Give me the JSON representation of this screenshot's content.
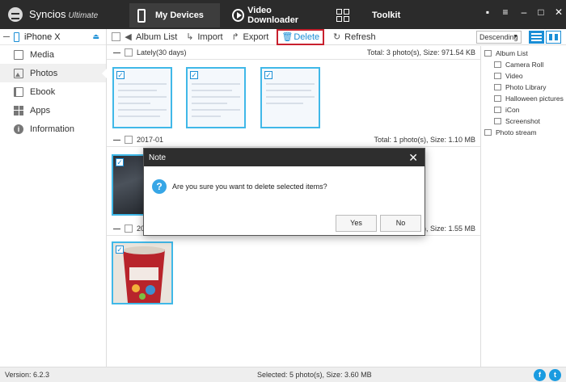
{
  "app": {
    "name": "Syncios",
    "edition": "Ultimate"
  },
  "nav_tabs": [
    {
      "label": "My Devices",
      "icon": "phone-icon"
    },
    {
      "label": "Video Downloader",
      "icon": "play-icon"
    },
    {
      "label": "Toolkit",
      "icon": "toolkit-grid-icon"
    }
  ],
  "window_controls": [
    "message-icon",
    "menu-icon",
    "minimize-icon",
    "maximize-icon",
    "close-icon"
  ],
  "device": {
    "name": "iPhone X"
  },
  "sidebar": {
    "items": [
      {
        "label": "Media",
        "icon": "media-icon"
      },
      {
        "label": "Photos",
        "icon": "photos-icon"
      },
      {
        "label": "Ebook",
        "icon": "ebook-icon"
      },
      {
        "label": "Apps",
        "icon": "apps-icon"
      },
      {
        "label": "Information",
        "icon": "info-icon"
      }
    ]
  },
  "toolbar": {
    "album_list": "Album List",
    "import": "Import",
    "export": "Export",
    "delete": "Delete",
    "refresh": "Refresh",
    "sort": "Descending",
    "accent_color": "#1a8ed6",
    "highlight_color": "#c8202e"
  },
  "groups": [
    {
      "title": "Lately(30 days)",
      "total": "Total: 3 photo(s), Size: 971.54 KB"
    },
    {
      "title": "2017-01",
      "total": "Total: 1 photo(s), Size: 1.10 MB"
    },
    {
      "title": "20",
      "total": "Total: 1 photo(s), Size: 1.55 MB"
    }
  ],
  "album_tree": {
    "root": "Album List",
    "children": [
      "Camera Roll",
      "Video",
      "Photo Library",
      "Halloween pictures",
      "iCon",
      "Screenshot"
    ],
    "stream": "Photo stream"
  },
  "status": {
    "version": "Version: 6.2.3",
    "selected": "Selected: 5 photo(s), Size: 3.60 MB"
  },
  "modal": {
    "title": "Note",
    "message": "Are you sure you want to delete selected items?",
    "yes": "Yes",
    "no": "No"
  },
  "social": {
    "facebook": "f",
    "twitter": "t"
  }
}
